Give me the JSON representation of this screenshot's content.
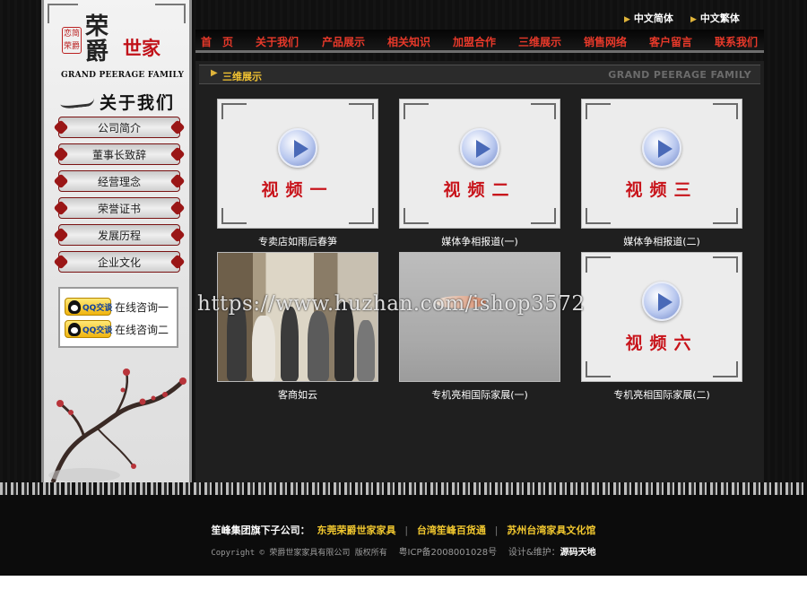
{
  "brand": {
    "seal_text": "恋简 荣爵",
    "name_cn_top": "荣爵",
    "name_cn_red": "世家",
    "name_en": "GRAND PEERAGE FAMILY"
  },
  "sidebar": {
    "section_title": "关于我们",
    "menu": [
      "公司简介",
      "董事长致辞",
      "经营理念",
      "荣誉证书",
      "发展历程",
      "企业文化"
    ],
    "qq": {
      "button_text": "QQ交谈",
      "items": [
        "在线咨询一",
        "在线咨询二"
      ]
    }
  },
  "header": {
    "lang": [
      "中文简体",
      "中文繁体"
    ],
    "nav": [
      "首　页",
      "关于我们",
      "产品展示",
      "相关知识",
      "加盟合作",
      "三维展示",
      "销售网络",
      "客户留言",
      "联系我们"
    ]
  },
  "breadcrumb": {
    "current": "三维展示",
    "english": "GRAND PEERAGE FAMILY"
  },
  "videos": [
    {
      "thumb_label": "视频一",
      "caption": "专卖店如雨后春笋",
      "thumb": "play-icon"
    },
    {
      "thumb_label": "视频二",
      "caption": "媒体争相报道(一)",
      "thumb": "play-icon"
    },
    {
      "thumb_label": "视频三",
      "caption": "媒体争相报道(二)",
      "thumb": "play-icon"
    },
    {
      "thumb_label": "",
      "caption": "客商如云",
      "thumb": "photo"
    },
    {
      "thumb_label": "",
      "caption": "专机亮相国际家展(一)",
      "thumb": "photo"
    },
    {
      "thumb_label": "视频六",
      "caption": "专机亮相国际家展(二)",
      "thumb": "play-icon"
    }
  ],
  "watermark": "https://www.huzhan.com/ishop3572",
  "footer": {
    "lead": "笙峰集团旗下子公司：",
    "links": [
      "东莞荣爵世家家具",
      "台湾笙峰百货通",
      "苏州台湾家具文化馆"
    ],
    "copyright": "Copyright © 荣爵世家家具有限公司 版权所有",
    "icp": "粤ICP备2008001028号",
    "design_label": "设计&维护：",
    "designer": "源码天地"
  },
  "colors": {
    "nav_red": "#e8392a",
    "accent_gold": "#f2c82f",
    "brand_red": "#c1121a"
  }
}
